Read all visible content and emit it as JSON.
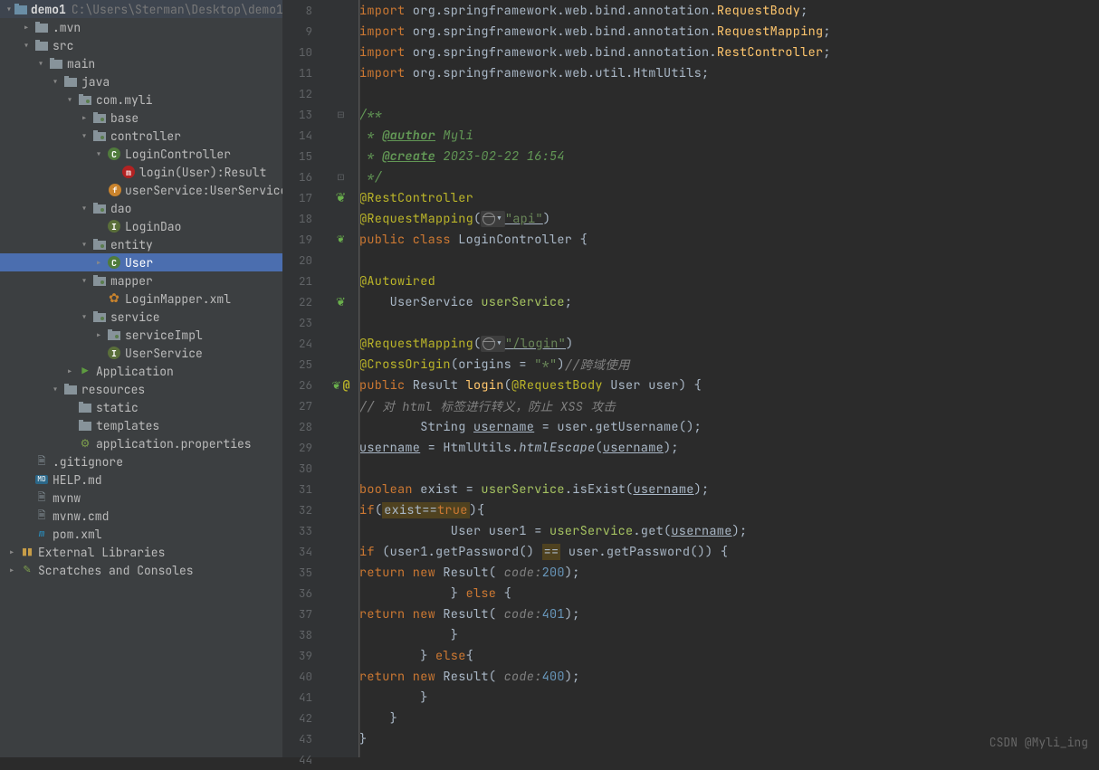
{
  "project": {
    "name": "demo1",
    "path": "C:\\Users\\Sterman\\Desktop\\demo1"
  },
  "tree": [
    {
      "indent": 0,
      "toggle": "v",
      "icon": "module",
      "label": "demo1",
      "suffix": "C:\\Users\\Sterman\\Desktop\\demo1",
      "bold": true
    },
    {
      "indent": 1,
      "toggle": ">",
      "icon": "folder",
      "label": ".mvn"
    },
    {
      "indent": 1,
      "toggle": "v",
      "icon": "folder",
      "label": "src"
    },
    {
      "indent": 2,
      "toggle": "v",
      "icon": "folder",
      "label": "main"
    },
    {
      "indent": 3,
      "toggle": "v",
      "icon": "folder",
      "label": "java",
      "folderColor": "#4a6ea9"
    },
    {
      "indent": 4,
      "toggle": "v",
      "icon": "package",
      "label": "com.myli"
    },
    {
      "indent": 5,
      "toggle": ">",
      "icon": "package",
      "label": "base"
    },
    {
      "indent": 5,
      "toggle": "v",
      "icon": "package",
      "label": "controller"
    },
    {
      "indent": 6,
      "toggle": "v",
      "icon": "class",
      "label": "LoginController"
    },
    {
      "indent": 7,
      "toggle": "",
      "icon": "method",
      "label": "login(User):Result"
    },
    {
      "indent": 7,
      "toggle": "",
      "icon": "field",
      "label": "userService:UserService"
    },
    {
      "indent": 5,
      "toggle": "v",
      "icon": "package",
      "label": "dao"
    },
    {
      "indent": 6,
      "toggle": "",
      "icon": "interface",
      "label": "LoginDao"
    },
    {
      "indent": 5,
      "toggle": "v",
      "icon": "package",
      "label": "entity"
    },
    {
      "indent": 6,
      "toggle": ">",
      "icon": "class",
      "label": "User",
      "selected": true
    },
    {
      "indent": 5,
      "toggle": "v",
      "icon": "package",
      "label": "mapper"
    },
    {
      "indent": 6,
      "toggle": "",
      "icon": "xml",
      "label": "LoginMapper.xml"
    },
    {
      "indent": 5,
      "toggle": "v",
      "icon": "package",
      "label": "service"
    },
    {
      "indent": 6,
      "toggle": ">",
      "icon": "package",
      "label": "serviceImpl"
    },
    {
      "indent": 6,
      "toggle": "",
      "icon": "interface",
      "label": "UserService"
    },
    {
      "indent": 4,
      "toggle": ">",
      "icon": "startup",
      "label": "Application"
    },
    {
      "indent": 3,
      "toggle": "v",
      "icon": "folder",
      "label": "resources",
      "folderColor": "#877b42"
    },
    {
      "indent": 4,
      "toggle": "",
      "icon": "folder",
      "label": "static"
    },
    {
      "indent": 4,
      "toggle": "",
      "icon": "folder",
      "label": "templates"
    },
    {
      "indent": 4,
      "toggle": "",
      "icon": "prop",
      "label": "application.properties"
    },
    {
      "indent": 1,
      "toggle": "",
      "icon": "file",
      "label": ".gitignore"
    },
    {
      "indent": 1,
      "toggle": "",
      "icon": "md",
      "label": "HELP.md"
    },
    {
      "indent": 1,
      "toggle": "",
      "icon": "file",
      "label": "mvnw"
    },
    {
      "indent": 1,
      "toggle": "",
      "icon": "file",
      "label": "mvnw.cmd"
    },
    {
      "indent": 1,
      "toggle": "",
      "icon": "maven",
      "label": "pom.xml"
    },
    {
      "indent": 0,
      "toggle": ">",
      "icon": "lib",
      "label": "External Libraries"
    },
    {
      "indent": 0,
      "toggle": ">",
      "icon": "scratch",
      "label": "Scratches and Consoles"
    }
  ],
  "firstLine": 8,
  "code": [
    {
      "html": "<span class='kw'>import</span> org.springframework.web.bind.annotation.<span class='fn'>RequestBody</span>;"
    },
    {
      "html": "<span class='kw'>import</span> org.springframework.web.bind.annotation.<span class='fn'>RequestMapping</span>;"
    },
    {
      "html": "<span class='kw'>import</span> org.springframework.web.bind.annotation.<span class='fn'>RestController</span>;"
    },
    {
      "html": "<span class='kw'>import</span> org.springframework.web.util.HtmlUtils;"
    },
    {
      "html": ""
    },
    {
      "html": "<span class='doc'>/**</span>",
      "fold": "start"
    },
    {
      "html": "<span class='doc'> * <span class='doc-tag'>@author</span> Myli</span>"
    },
    {
      "html": "<span class='doc'> * <span class='doc-tag'>@create</span> 2023-02-22 16:54</span>"
    },
    {
      "html": "<span class='doc'> */</span>",
      "fold": "end"
    },
    {
      "html": "<span class='ann'>@RestController</span>",
      "icon": "spring"
    },
    {
      "html": "<span class='ann'>@RequestMapping</span>(<span class='hintbox'><span class='globe-icon'></span>&#9662;</span><span class='str und'>\"api\"</span>)"
    },
    {
      "html": "<span class='kw'>public class</span> LoginController {",
      "icon": "run"
    },
    {
      "html": ""
    },
    {
      "html": "    <span class='ann'>@Autowired</span>"
    },
    {
      "html": "    UserService <span class='yield'>userService</span>;",
      "icon": "bean"
    },
    {
      "html": ""
    },
    {
      "html": "    <span class='ann'>@RequestMapping</span>(<span class='hintbox'><span class='globe-icon'></span>&#9662;</span><span class='str und'>\"/login\"</span>)"
    },
    {
      "html": "    <span class='ann'>@CrossOrigin</span>(origins = <span class='str'>\"*\"</span>)<span class='cmt'>//跨域使用</span>"
    },
    {
      "html": "    <span class='kw'>public</span> Result <span class='fn'>login</span>(<span class='ann'>@RequestBody</span> User user) {",
      "icon": "run-at"
    },
    {
      "html": "        <span class='cmt'>// 对 html 标签进行转义，防止 XSS 攻击</span>"
    },
    {
      "html": "        String <span class='und'>username</span> = user.getUsername();"
    },
    {
      "html": "        <span class='und'>username</span> = HtmlUtils.<span style='font-style:italic'>htmlEscape</span>(<span class='und'>username</span>);"
    },
    {
      "html": ""
    },
    {
      "html": "        <span class='kw'>boolean</span> exist = <span class='yield'>userService</span>.isExist(<span class='und'>username</span>);"
    },
    {
      "html": "        <span class='kw'>if</span>(<span class='hl-eq'>exist==<span class='kw'>true</span></span>){"
    },
    {
      "html": "            User user1 = <span class='yield'>userService</span>.get(<span class='und'>username</span>);"
    },
    {
      "html": "            <span class='kw'>if</span> (user1.getPassword() <span class='hl-eq'>==</span> user.getPassword()) {"
    },
    {
      "html": "                <span class='kw'>return new</span> Result( <span class='param'>code:</span> <span class='num'>200</span>);"
    },
    {
      "html": "            } <span class='kw'>else</span> {"
    },
    {
      "html": "                <span class='kw'>return new</span> Result( <span class='param'>code:</span> <span class='num'>401</span>);"
    },
    {
      "html": "            }"
    },
    {
      "html": "        } <span class='kw'>else</span>{"
    },
    {
      "html": "            <span class='kw'>return new</span> Result( <span class='param'>code:</span> <span class='num'>400</span>);"
    },
    {
      "html": "        }"
    },
    {
      "html": "    }"
    },
    {
      "html": "}"
    },
    {
      "html": ""
    }
  ],
  "watermark": "CSDN @Myli_ing"
}
